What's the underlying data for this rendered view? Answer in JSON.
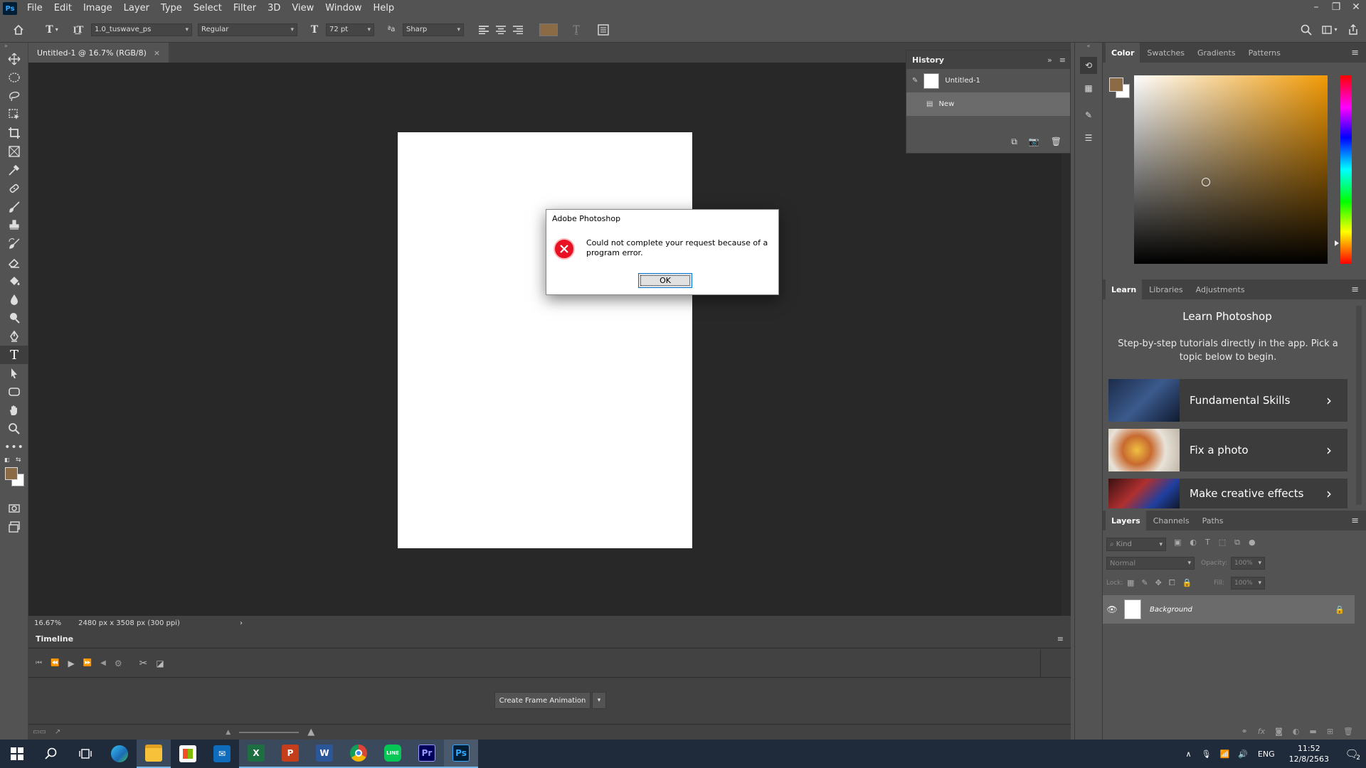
{
  "app": {
    "logo_text": "Ps"
  },
  "menu": [
    "File",
    "Edit",
    "Image",
    "Layer",
    "Type",
    "Select",
    "Filter",
    "3D",
    "View",
    "Window",
    "Help"
  ],
  "options_bar": {
    "font_family": "1.0_tuswave_ps",
    "font_style": "Regular",
    "font_size": "72 pt",
    "antialias": "Sharp",
    "text_color": "#8b6b45"
  },
  "document": {
    "tab_title": "Untitled-1 @ 16.7% (RGB/8)",
    "zoom": "16.67%",
    "doc_info": "2480 px x 3508 px (300 ppi)"
  },
  "history": {
    "title": "History",
    "items": [
      {
        "label": "Untitled-1",
        "selected": false
      },
      {
        "label": "New",
        "selected": true
      }
    ]
  },
  "dialog": {
    "title": "Adobe Photoshop",
    "message": "Could not complete your request because of a program error.",
    "ok_label": "OK"
  },
  "color_panel": {
    "tabs": [
      "Color",
      "Swatches",
      "Gradients",
      "Patterns"
    ],
    "hue_color": "#f29a05",
    "foreground": "#8b6b45",
    "background": "#ffffff"
  },
  "learn_panel": {
    "tabs": [
      "Learn",
      "Libraries",
      "Adjustments"
    ],
    "heading": "Learn Photoshop",
    "description": "Step-by-step tutorials directly in the app. Pick a topic below to begin.",
    "cards": [
      "Fundamental Skills",
      "Fix a photo",
      "Make creative effects"
    ]
  },
  "layers_panel": {
    "tabs": [
      "Layers",
      "Channels",
      "Paths"
    ],
    "kind_placeholder": "Kind",
    "blend_mode": "Normal",
    "opacity_label": "Opacity:",
    "opacity_value": "100%",
    "lock_label": "Lock:",
    "fill_label": "Fill:",
    "fill_value": "100%",
    "layers": [
      {
        "name": "Background",
        "locked": true,
        "visible": true
      }
    ]
  },
  "timeline": {
    "title": "Timeline",
    "create_button": "Create Frame Animation"
  },
  "taskbar": {
    "apps": [
      "start",
      "search",
      "task-view",
      "edge",
      "file-explorer",
      "store",
      "mail",
      "excel",
      "powerpoint",
      "word",
      "chrome",
      "line",
      "premiere",
      "photoshop"
    ],
    "language": "ENG",
    "time": "11:52",
    "date": "12/8/2563",
    "notification_count": "2"
  }
}
